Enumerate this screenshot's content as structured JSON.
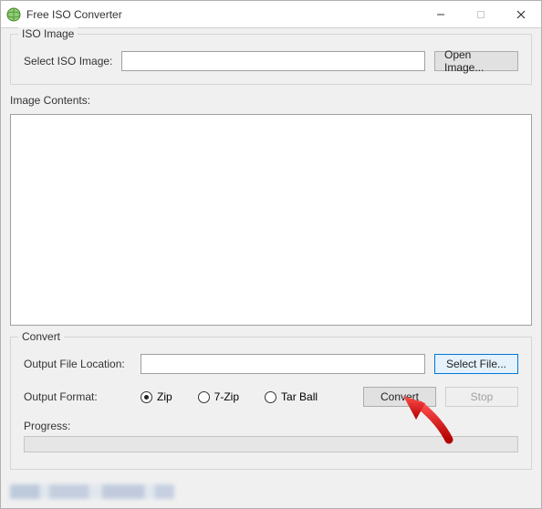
{
  "window": {
    "title": "Free ISO Converter"
  },
  "iso_group": {
    "legend": "ISO Image",
    "select_label": "Select ISO Image:",
    "open_button": "Open Image...",
    "path_value": ""
  },
  "contents": {
    "label": "Image Contents:"
  },
  "convert_group": {
    "legend": "Convert",
    "output_location_label": "Output File Location:",
    "output_location_value": "",
    "select_file_button": "Select File...",
    "output_format_label": "Output Format:",
    "formats": {
      "zip": "Zip",
      "sevenzip": "7-Zip",
      "tarball": "Tar Ball"
    },
    "selected_format": "zip",
    "convert_button": "Convert",
    "stop_button": "Stop",
    "progress_label": "Progress:"
  }
}
